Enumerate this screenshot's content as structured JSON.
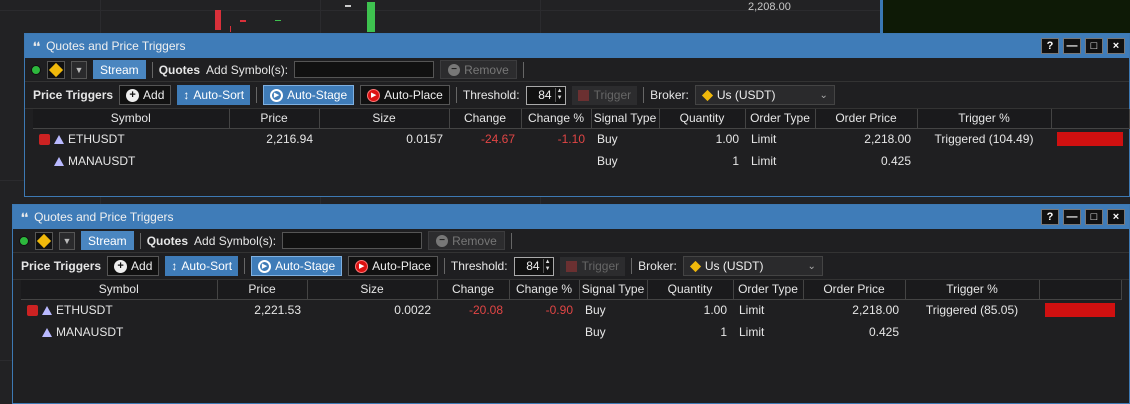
{
  "background": {
    "price_label": "2,208.00"
  },
  "colors": {
    "title_bar": "#3f7cb8",
    "negative": "#e04545",
    "trigger_bar": "#d01010",
    "binance": "#f0b90b"
  },
  "windows": [
    {
      "title": "Quotes and Price Triggers",
      "title_icon": "quote-icon",
      "title_buttons": [
        "?",
        "—",
        "□",
        "×"
      ],
      "toolbar": {
        "stream_label": "Stream",
        "quotes_label": "Quotes",
        "add_symbol_label": "Add Symbol(s):",
        "add_symbol_value": "",
        "remove_label": "Remove"
      },
      "triggers_bar": {
        "label": "Price Triggers",
        "add_label": "Add",
        "auto_sort_label": "Auto-Sort",
        "auto_stage_label": "Auto-Stage",
        "auto_place_label": "Auto-Place",
        "threshold_label": "Threshold:",
        "threshold_value": "84",
        "trigger_label": "Trigger",
        "broker_label": "Broker:",
        "broker_value": "Us (USDT)"
      },
      "columns": [
        "Symbol",
        "Price",
        "Size",
        "Change",
        "Change %",
        "Signal Type",
        "Quantity",
        "Order Type",
        "Order Price",
        "Trigger %",
        ""
      ],
      "rows": [
        {
          "triggered_icon": true,
          "symbol": "ETHUSDT",
          "price": "2,216.94",
          "size": "0.0157",
          "change": "-24.67",
          "change_pct": "-1.10",
          "signal": "Buy",
          "quantity": "1.00",
          "order_type": "Limit",
          "order_price": "2,218.00",
          "trigger": "Triggered (104.49)",
          "bar_fraction": 1.0
        },
        {
          "triggered_icon": false,
          "symbol": "MANAUSDT",
          "price": "",
          "size": "",
          "change": "",
          "change_pct": "",
          "signal": "Buy",
          "quantity": "1",
          "order_type": "Limit",
          "order_price": "0.425",
          "trigger": "",
          "bar_fraction": 0
        }
      ]
    },
    {
      "title": "Quotes and Price Triggers",
      "title_icon": "quote-icon",
      "title_buttons": [
        "?",
        "—",
        "□",
        "×"
      ],
      "toolbar": {
        "stream_label": "Stream",
        "quotes_label": "Quotes",
        "add_symbol_label": "Add Symbol(s):",
        "add_symbol_value": "",
        "remove_label": "Remove"
      },
      "triggers_bar": {
        "label": "Price Triggers",
        "add_label": "Add",
        "auto_sort_label": "Auto-Sort",
        "auto_stage_label": "Auto-Stage",
        "auto_place_label": "Auto-Place",
        "threshold_label": "Threshold:",
        "threshold_value": "84",
        "trigger_label": "Trigger",
        "broker_label": "Broker:",
        "broker_value": "Us (USDT)"
      },
      "columns": [
        "Symbol",
        "Price",
        "Size",
        "Change",
        "Change %",
        "Signal Type",
        "Quantity",
        "Order Type",
        "Order Price",
        "Trigger %",
        ""
      ],
      "rows": [
        {
          "triggered_icon": true,
          "symbol": "ETHUSDT",
          "price": "2,221.53",
          "size": "0.0022",
          "change": "-20.08",
          "change_pct": "-0.90",
          "signal": "Buy",
          "quantity": "1.00",
          "order_type": "Limit",
          "order_price": "2,218.00",
          "trigger": "Triggered (85.05)",
          "bar_fraction": 1.0
        },
        {
          "triggered_icon": false,
          "symbol": "MANAUSDT",
          "price": "",
          "size": "",
          "change": "",
          "change_pct": "",
          "signal": "Buy",
          "quantity": "1",
          "order_type": "Limit",
          "order_price": "0.425",
          "trigger": "",
          "bar_fraction": 0
        }
      ]
    }
  ]
}
